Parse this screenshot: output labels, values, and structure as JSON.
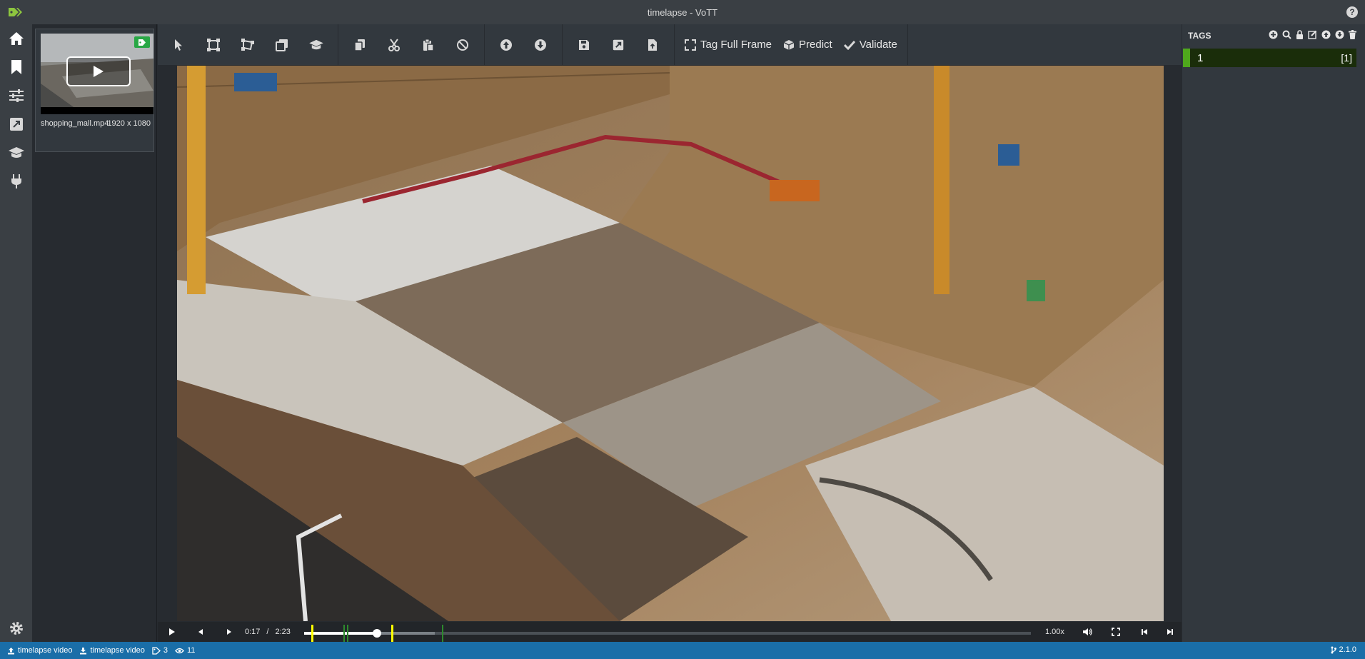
{
  "window": {
    "title": "timelapse - VoTT"
  },
  "nav": {
    "items": [
      {
        "name": "home",
        "icon": "home-icon"
      },
      {
        "name": "tag-editor",
        "icon": "bookmark-icon"
      },
      {
        "name": "settings",
        "icon": "sliders-icon"
      },
      {
        "name": "export",
        "icon": "external-link-icon"
      },
      {
        "name": "active-learning",
        "icon": "graduation-cap-icon"
      },
      {
        "name": "connections",
        "icon": "plug-icon"
      }
    ],
    "bottom_icon": "gear-icon"
  },
  "assets": {
    "items": [
      {
        "name": "shopping_mall.mp4",
        "size": "1920 x 1080",
        "tagged": true
      }
    ]
  },
  "toolbar": {
    "tag_full_frame": "Tag Full Frame",
    "predict": "Predict",
    "validate": "Validate"
  },
  "video": {
    "current_time": "0:17",
    "separator": "/",
    "duration": "2:23",
    "speed": "1.00x",
    "progress_fraction": 0.1,
    "buffered_fraction": 0.18
  },
  "tags": {
    "header": "TAGS",
    "items": [
      {
        "name": "1",
        "hotkey": "[1]",
        "color": "#4fa81c"
      }
    ]
  },
  "status": {
    "source_connection": "timelapse video",
    "target_connection": "timelapse video",
    "tag_count": "3",
    "visited_count": "11",
    "version": "2.1.0"
  },
  "colors": {
    "accent": "#1a6ea8",
    "tag_green": "#4fa81c",
    "badge_green": "#28a745",
    "marker_yellow": "#ffff00"
  }
}
